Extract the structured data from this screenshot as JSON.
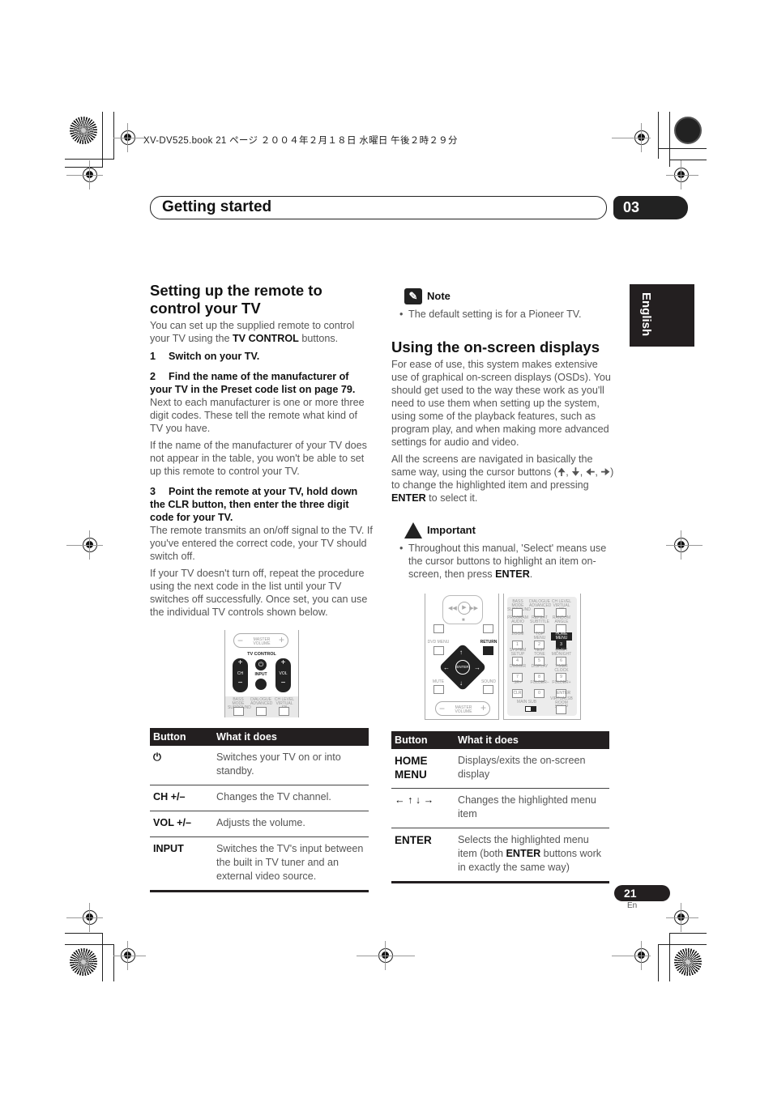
{
  "print_header": "XV-DV525.book  21 ページ  ２００４年２月１８日  水曜日  午後２時２９分",
  "chapter": {
    "title": "Getting started",
    "number": "03"
  },
  "language_tab": "English",
  "left": {
    "heading": "Setting up the remote to control your TV",
    "intro_pre": "You can set up the supplied remote to control your TV using the ",
    "intro_bold": "TV CONTROL",
    "intro_post": " buttons.",
    "steps": [
      {
        "num": "1",
        "text": "Switch on your TV."
      },
      {
        "num": "2",
        "text": "Find the name of the manufacturer of your TV in the Preset code list on page 79."
      },
      {
        "num": "3",
        "text": "Point the remote at your TV, hold down the CLR button, then enter the three digit code for your TV."
      }
    ],
    "step2_body": "Next to each manufacturer is one or more three digit codes. These tell the remote what kind of TV you have.",
    "step2_body2": "If the name of the manufacturer of your TV does not appear in the table, you won't be able to set up this remote to control your TV.",
    "step3_body": "The remote transmits an on/off signal to the TV. If you've entered the correct code, your TV should switch off.",
    "step3_body2": "If your TV doesn't turn off, repeat the procedure using the next code in the list until your TV switches off successfully. Once set, you can use the individual TV controls shown below.",
    "remote": {
      "master_volume": "MASTER VOLUME",
      "tv_control": "TV CONTROL",
      "ch": "CH",
      "input": "INPUT",
      "vol": "VOL",
      "bottom_labels": [
        "BASS MODE SURROUND",
        "DIALOGUE ADVANCED",
        "CH LEVEL VIRTUAL SB"
      ]
    },
    "table": {
      "headers": [
        "Button",
        "What it does"
      ],
      "rows": [
        {
          "button": "⏻",
          "desc": "Switches your TV on or into standby."
        },
        {
          "button": "CH +/–",
          "desc": "Changes the TV channel."
        },
        {
          "button": "VOL +/–",
          "desc": "Adjusts the volume."
        },
        {
          "button": "INPUT",
          "desc": "Switches the TV's input between the built in TV tuner and an external video source."
        }
      ]
    }
  },
  "right": {
    "note_title": "Note",
    "note_text": "The default setting is for a Pioneer TV.",
    "heading": "Using the on-screen displays",
    "para1": "For ease of use, this system makes extensive use of graphical on-screen displays (OSDs). You should get used to the way these work as you'll need to use them when setting up the system, using some of the playback features, such as program play, and when making more advanced settings for audio and video.",
    "para2_pre": "All the screens are navigated in basically the same way, using the cursor buttons (🠉, 🠋, 🠈, 🠊) to change the highlighted item and pressing ",
    "para2_bold": "ENTER",
    "para2_post": " to select it.",
    "important_title": "Important",
    "important_pre": "Throughout this manual, 'Select' means use the cursor buttons to highlight an item on-screen, then press ",
    "important_bold": "ENTER",
    "important_post": ".",
    "remote": {
      "dvd_menu": "DVD MENU",
      "return": "RETURN",
      "enter": "ENTER",
      "mute": "MUTE",
      "sound": "SOUND",
      "master_volume": "MASTER VOLUME",
      "keys": [
        [
          "BASS MODE SURROUND",
          "DIALOGUE ADVANCED",
          "CH LEVEL VIRTUAL SB"
        ],
        [
          "PROGRAM AUDIO",
          "REPEAT SUBTITLE",
          "RANDOM ANGLE"
        ],
        [
          "ZOOM",
          "TOP MENU",
          "HOME MENU"
        ],
        [
          "SYSTEM SETUP",
          "TEST TONE",
          "QUIET MIDNIGHT"
        ],
        [
          "DIMMER",
          "DISPLAY",
          "TIMER CLOCK"
        ],
        [
          "SR+",
          "FOLDER–",
          "FOLDER+"
        ]
      ],
      "digits": [
        "1",
        "2",
        "3",
        "4",
        "5",
        "6",
        "7",
        "8",
        "9",
        "CLR",
        "0",
        "ENTER"
      ],
      "main_sub": [
        "MAIN",
        "SUB"
      ],
      "room_setup": "VIRTUALSB ROOM SETUP"
    },
    "table": {
      "headers": [
        "Button",
        "What it does"
      ],
      "rows": [
        {
          "button": "HOME MENU",
          "desc": "Displays/exits the on-screen display"
        },
        {
          "button": "← ↑ ↓ →",
          "desc": "Changes the highlighted menu item"
        },
        {
          "button": "ENTER",
          "desc_pre": "Selects the highlighted menu item (both ",
          "desc_bold": "ENTER",
          "desc_post": " buttons work in exactly the same way)"
        }
      ]
    }
  },
  "footer": {
    "page": "21",
    "lang": "En"
  }
}
